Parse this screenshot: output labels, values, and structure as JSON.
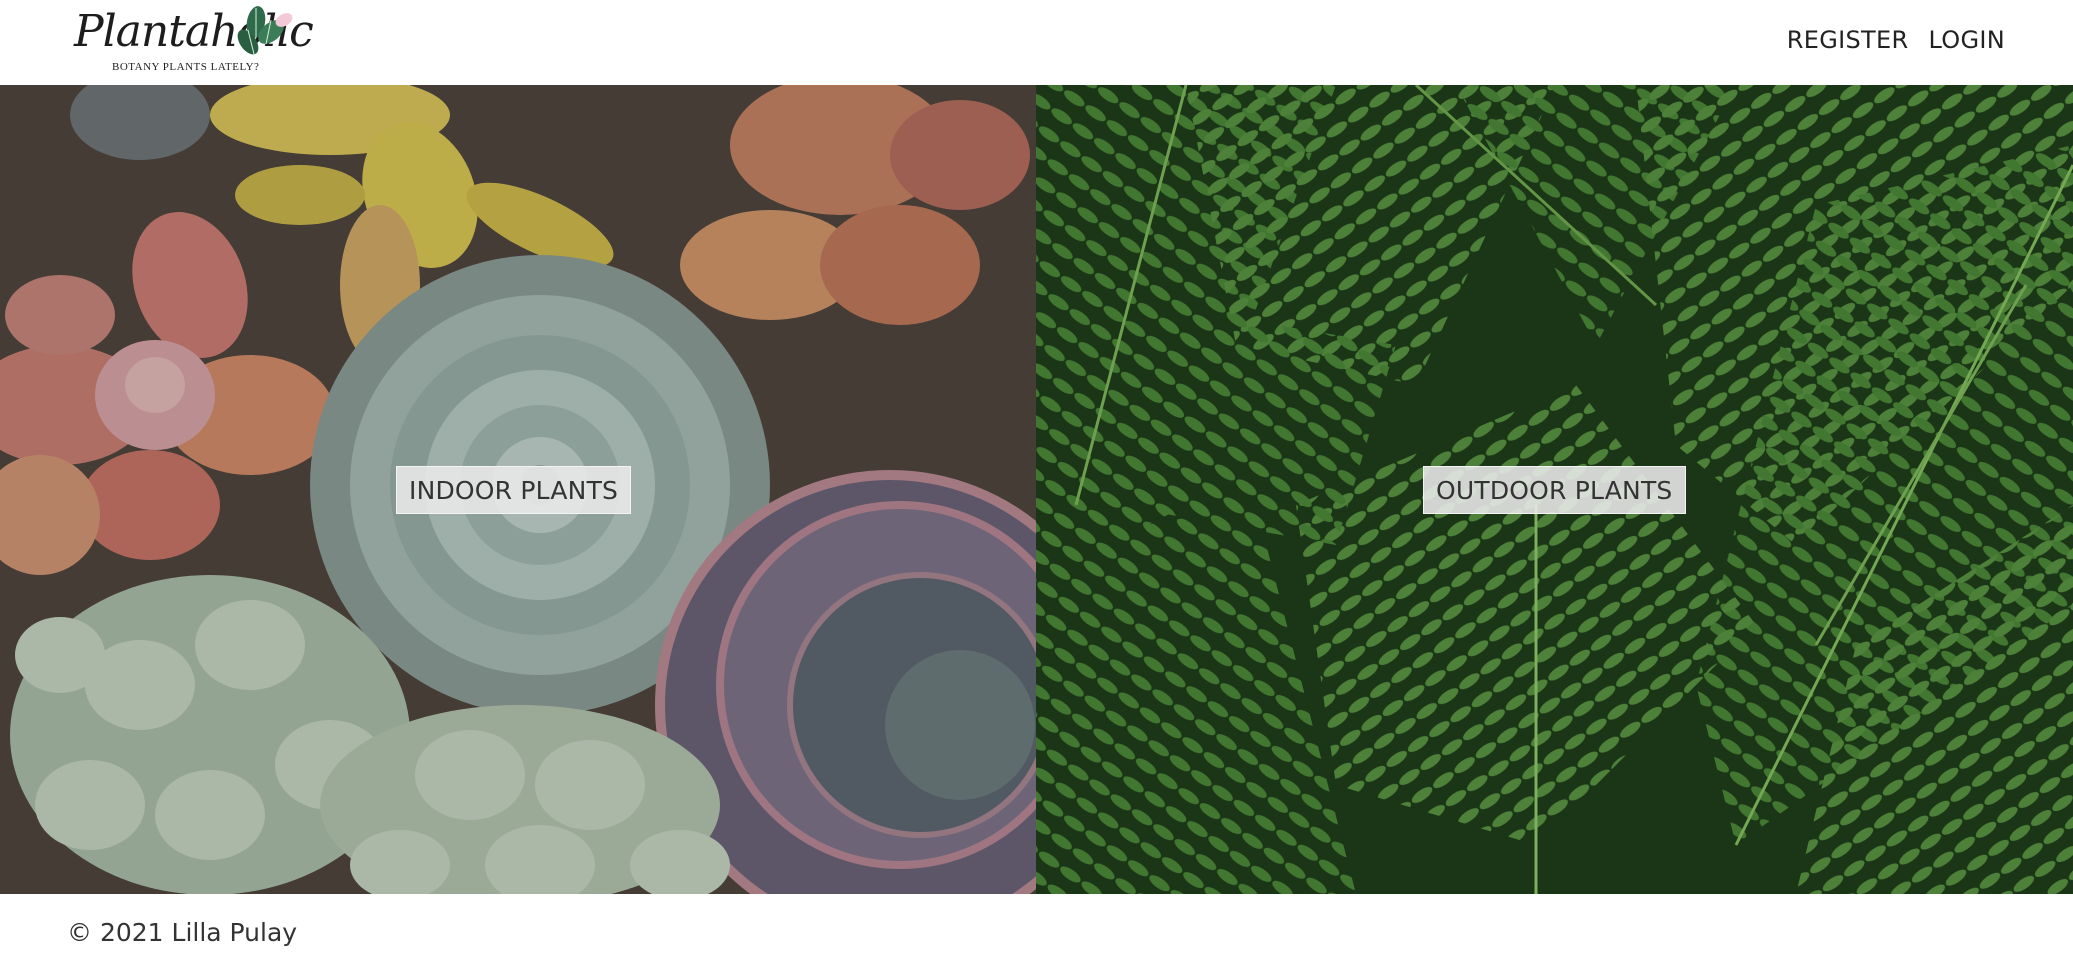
{
  "header": {
    "logo": {
      "name": "Plantaholic",
      "tagline": "BOTANY PLANTS LATELY?"
    },
    "nav": [
      {
        "label": "REGISTER"
      },
      {
        "label": "LOGIN"
      }
    ]
  },
  "panels": [
    {
      "label": "INDOOR PLANTS",
      "image": "succulents-photo"
    },
    {
      "label": "OUTDOOR PLANTS",
      "image": "fern-photo"
    }
  ],
  "footer": {
    "copyright": "© 2021 Lilla Pulay"
  },
  "colors": {
    "background": "#ffffff",
    "text": "#222222",
    "label_bg": "#ebebeb",
    "fern_green": "#3f7a2e",
    "succulent_teal": "#b9ccc5"
  }
}
